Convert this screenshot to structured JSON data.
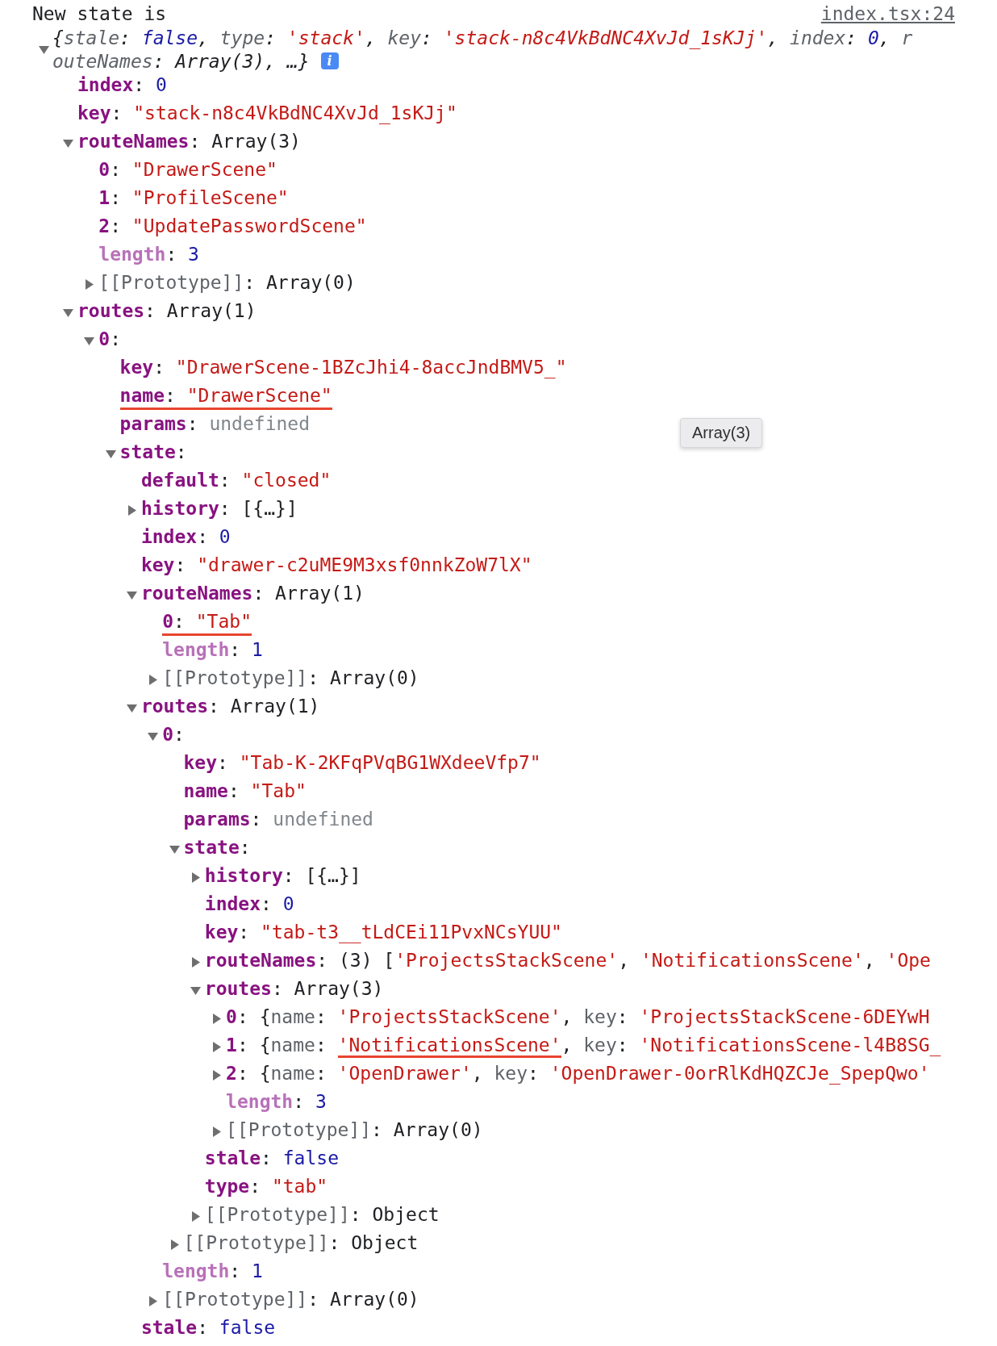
{
  "log": {
    "message": "New state is",
    "source": "index.tsx:24",
    "summary": {
      "expanded": true,
      "info_badge": "i",
      "lines": [
        [
          {
            "text": "{",
            "kind": "plain"
          },
          {
            "text": "stale",
            "kind": "prop"
          },
          {
            "text": ": ",
            "kind": "plain"
          },
          {
            "text": "false",
            "kind": "number"
          },
          {
            "text": ", ",
            "kind": "plain"
          },
          {
            "text": "type",
            "kind": "prop"
          },
          {
            "text": ": ",
            "kind": "plain"
          },
          {
            "text": "'stack'",
            "kind": "string"
          },
          {
            "text": ", ",
            "kind": "plain"
          },
          {
            "text": "key",
            "kind": "prop"
          },
          {
            "text": ": ",
            "kind": "plain"
          },
          {
            "text": "'stack-n8c4VkBdNC4XvJd_1sKJj'",
            "kind": "string"
          },
          {
            "text": ", ",
            "kind": "plain"
          },
          {
            "text": "index",
            "kind": "prop"
          },
          {
            "text": ": ",
            "kind": "plain"
          },
          {
            "text": "0",
            "kind": "number"
          },
          {
            "text": ", ",
            "kind": "plain"
          },
          {
            "text": "r",
            "kind": "prop"
          }
        ],
        [
          {
            "text": "outeNames",
            "kind": "prop"
          },
          {
            "text": ": Array(3), …}",
            "kind": "plain"
          }
        ]
      ]
    },
    "children": [
      {
        "key": "index",
        "kind": "own",
        "value": [
          {
            "text": ": ",
            "kind": "plain"
          },
          {
            "text": "0",
            "kind": "number"
          }
        ]
      },
      {
        "key": "key",
        "kind": "own",
        "value": [
          {
            "text": ": ",
            "kind": "plain"
          },
          {
            "text": "\"stack-n8c4VkBdNC4XvJd_1sKJj\"",
            "kind": "string"
          }
        ]
      },
      {
        "key": "routeNames",
        "kind": "own",
        "expanded": true,
        "value": [
          {
            "text": ": Array(3)",
            "kind": "plain"
          }
        ],
        "children": [
          {
            "key": "0",
            "kind": "own",
            "value": [
              {
                "text": ": ",
                "kind": "plain"
              },
              {
                "text": "\"DrawerScene\"",
                "kind": "string"
              }
            ]
          },
          {
            "key": "1",
            "kind": "own",
            "value": [
              {
                "text": ": ",
                "kind": "plain"
              },
              {
                "text": "\"ProfileScene\"",
                "kind": "string"
              }
            ]
          },
          {
            "key": "2",
            "kind": "own",
            "value": [
              {
                "text": ": ",
                "kind": "plain"
              },
              {
                "text": "\"UpdatePasswordScene\"",
                "kind": "string"
              }
            ]
          },
          {
            "key": "length",
            "kind": "internal",
            "value": [
              {
                "text": ": ",
                "kind": "plain"
              },
              {
                "text": "3",
                "kind": "number"
              }
            ]
          },
          {
            "key": "[[Prototype]]",
            "kind": "proto",
            "expanded": false,
            "value": [
              {
                "text": ": Array(0)",
                "kind": "plain"
              }
            ]
          }
        ]
      },
      {
        "key": "routes",
        "kind": "own",
        "expanded": true,
        "value": [
          {
            "text": ": Array(1)",
            "kind": "plain"
          }
        ],
        "children": [
          {
            "key": "0",
            "kind": "own",
            "expanded": true,
            "value": [
              {
                "text": ":",
                "kind": "plain"
              }
            ],
            "children": [
              {
                "key": "key",
                "kind": "own",
                "value": [
                  {
                    "text": ": ",
                    "kind": "plain"
                  },
                  {
                    "text": "\"DrawerScene-1BZcJhi4-8accJndBMV5_\"",
                    "kind": "string"
                  }
                ]
              },
              {
                "key": "name",
                "kind": "own",
                "underlined": true,
                "value": [
                  {
                    "text": ": ",
                    "kind": "plain"
                  },
                  {
                    "text": "\"DrawerScene\"",
                    "kind": "string"
                  }
                ]
              },
              {
                "key": "params",
                "kind": "own",
                "value": [
                  {
                    "text": ": ",
                    "kind": "plain"
                  },
                  {
                    "text": "undefined",
                    "kind": "undefined"
                  }
                ]
              },
              {
                "key": "state",
                "kind": "own",
                "expanded": true,
                "value": [
                  {
                    "text": ":",
                    "kind": "plain"
                  }
                ],
                "children": [
                  {
                    "key": "default",
                    "kind": "own",
                    "value": [
                      {
                        "text": ": ",
                        "kind": "plain"
                      },
                      {
                        "text": "\"closed\"",
                        "kind": "string"
                      }
                    ]
                  },
                  {
                    "key": "history",
                    "kind": "own",
                    "expanded": false,
                    "value": [
                      {
                        "text": ": [{…}]",
                        "kind": "plain"
                      }
                    ]
                  },
                  {
                    "key": "index",
                    "kind": "own",
                    "value": [
                      {
                        "text": ": ",
                        "kind": "plain"
                      },
                      {
                        "text": "0",
                        "kind": "number"
                      }
                    ]
                  },
                  {
                    "key": "key",
                    "kind": "own",
                    "value": [
                      {
                        "text": ": ",
                        "kind": "plain"
                      },
                      {
                        "text": "\"drawer-c2uME9M3xsf0nnkZoW7lX\"",
                        "kind": "string"
                      }
                    ]
                  },
                  {
                    "key": "routeNames",
                    "kind": "own",
                    "expanded": true,
                    "value": [
                      {
                        "text": ": Array(1)",
                        "kind": "plain"
                      }
                    ],
                    "children": [
                      {
                        "key": "0",
                        "kind": "own",
                        "underlined": true,
                        "value": [
                          {
                            "text": ": ",
                            "kind": "plain"
                          },
                          {
                            "text": "\"Tab\"",
                            "kind": "string"
                          }
                        ]
                      },
                      {
                        "key": "length",
                        "kind": "internal",
                        "value": [
                          {
                            "text": ": ",
                            "kind": "plain"
                          },
                          {
                            "text": "1",
                            "kind": "number"
                          }
                        ]
                      },
                      {
                        "key": "[[Prototype]]",
                        "kind": "proto",
                        "expanded": false,
                        "value": [
                          {
                            "text": ": Array(0)",
                            "kind": "plain"
                          }
                        ]
                      }
                    ]
                  },
                  {
                    "key": "routes",
                    "kind": "own",
                    "expanded": true,
                    "value": [
                      {
                        "text": ": Array(1)",
                        "kind": "plain"
                      }
                    ],
                    "children": [
                      {
                        "key": "0",
                        "kind": "own",
                        "expanded": true,
                        "value": [
                          {
                            "text": ":",
                            "kind": "plain"
                          }
                        ],
                        "children": [
                          {
                            "key": "key",
                            "kind": "own",
                            "value": [
                              {
                                "text": ": ",
                                "kind": "plain"
                              },
                              {
                                "text": "\"Tab-K-2KFqPVqBG1WXdeeVfp7\"",
                                "kind": "string"
                              }
                            ]
                          },
                          {
                            "key": "name",
                            "kind": "own",
                            "value": [
                              {
                                "text": ": ",
                                "kind": "plain"
                              },
                              {
                                "text": "\"Tab\"",
                                "kind": "string"
                              }
                            ]
                          },
                          {
                            "key": "params",
                            "kind": "own",
                            "value": [
                              {
                                "text": ": ",
                                "kind": "plain"
                              },
                              {
                                "text": "undefined",
                                "kind": "undefined"
                              }
                            ]
                          },
                          {
                            "key": "state",
                            "kind": "own",
                            "expanded": true,
                            "value": [
                              {
                                "text": ":",
                                "kind": "plain"
                              }
                            ],
                            "children": [
                              {
                                "key": "history",
                                "kind": "own",
                                "expanded": false,
                                "value": [
                                  {
                                    "text": ": [{…}]",
                                    "kind": "plain"
                                  }
                                ]
                              },
                              {
                                "key": "index",
                                "kind": "own",
                                "value": [
                                  {
                                    "text": ": ",
                                    "kind": "plain"
                                  },
                                  {
                                    "text": "0",
                                    "kind": "number"
                                  }
                                ]
                              },
                              {
                                "key": "key",
                                "kind": "own",
                                "value": [
                                  {
                                    "text": ": ",
                                    "kind": "plain"
                                  },
                                  {
                                    "text": "\"tab-t3__tLdCEi11PvxNCsYUU\"",
                                    "kind": "string"
                                  }
                                ]
                              },
                              {
                                "key": "routeNames",
                                "kind": "own",
                                "expanded": false,
                                "value": [
                                  {
                                    "text": ": (3) [",
                                    "kind": "plain"
                                  },
                                  {
                                    "text": "'ProjectsStackScene'",
                                    "kind": "string"
                                  },
                                  {
                                    "text": ", ",
                                    "kind": "plain"
                                  },
                                  {
                                    "text": "'NotificationsScene'",
                                    "kind": "string"
                                  },
                                  {
                                    "text": ", ",
                                    "kind": "plain"
                                  },
                                  {
                                    "text": "'Ope",
                                    "kind": "string"
                                  }
                                ]
                              },
                              {
                                "key": "routes",
                                "kind": "own",
                                "expanded": true,
                                "value": [
                                  {
                                    "text": ": Array(3)",
                                    "kind": "plain"
                                  }
                                ],
                                "children": [
                                  {
                                    "key": "0",
                                    "kind": "own",
                                    "expanded": false,
                                    "value": [
                                      {
                                        "text": ": {",
                                        "kind": "plain"
                                      },
                                      {
                                        "text": "name",
                                        "kind": "prop"
                                      },
                                      {
                                        "text": ": ",
                                        "kind": "plain"
                                      },
                                      {
                                        "text": "'ProjectsStackScene'",
                                        "kind": "string"
                                      },
                                      {
                                        "text": ", ",
                                        "kind": "plain"
                                      },
                                      {
                                        "text": "key",
                                        "kind": "prop"
                                      },
                                      {
                                        "text": ": ",
                                        "kind": "plain"
                                      },
                                      {
                                        "text": "'ProjectsStackScene-6DEYwH",
                                        "kind": "string"
                                      }
                                    ]
                                  },
                                  {
                                    "key": "1",
                                    "kind": "own",
                                    "expanded": false,
                                    "value": [
                                      {
                                        "text": ": {",
                                        "kind": "plain"
                                      },
                                      {
                                        "text": "name",
                                        "kind": "prop"
                                      },
                                      {
                                        "text": ": ",
                                        "kind": "plain"
                                      },
                                      {
                                        "text": "'NotificationsScene'",
                                        "kind": "string",
                                        "underlined": true
                                      },
                                      {
                                        "text": ", ",
                                        "kind": "plain"
                                      },
                                      {
                                        "text": "key",
                                        "kind": "prop"
                                      },
                                      {
                                        "text": ": ",
                                        "kind": "plain"
                                      },
                                      {
                                        "text": "'NotificationsScene-l4B8SG_",
                                        "kind": "string"
                                      }
                                    ]
                                  },
                                  {
                                    "key": "2",
                                    "kind": "own",
                                    "expanded": false,
                                    "value": [
                                      {
                                        "text": ": {",
                                        "kind": "plain"
                                      },
                                      {
                                        "text": "name",
                                        "kind": "prop"
                                      },
                                      {
                                        "text": ": ",
                                        "kind": "plain"
                                      },
                                      {
                                        "text": "'OpenDrawer'",
                                        "kind": "string"
                                      },
                                      {
                                        "text": ", ",
                                        "kind": "plain"
                                      },
                                      {
                                        "text": "key",
                                        "kind": "prop"
                                      },
                                      {
                                        "text": ": ",
                                        "kind": "plain"
                                      },
                                      {
                                        "text": "'OpenDrawer-0orRlKdHQZCJe_SpepQwo'",
                                        "kind": "string"
                                      }
                                    ]
                                  },
                                  {
                                    "key": "length",
                                    "kind": "internal",
                                    "value": [
                                      {
                                        "text": ": ",
                                        "kind": "plain"
                                      },
                                      {
                                        "text": "3",
                                        "kind": "number"
                                      }
                                    ]
                                  },
                                  {
                                    "key": "[[Prototype]]",
                                    "kind": "proto",
                                    "expanded": false,
                                    "value": [
                                      {
                                        "text": ": Array(0)",
                                        "kind": "plain"
                                      }
                                    ]
                                  }
                                ]
                              },
                              {
                                "key": "stale",
                                "kind": "own",
                                "value": [
                                  {
                                    "text": ": ",
                                    "kind": "plain"
                                  },
                                  {
                                    "text": "false",
                                    "kind": "number"
                                  }
                                ]
                              },
                              {
                                "key": "type",
                                "kind": "own",
                                "value": [
                                  {
                                    "text": ": ",
                                    "kind": "plain"
                                  },
                                  {
                                    "text": "\"tab\"",
                                    "kind": "string"
                                  }
                                ]
                              },
                              {
                                "key": "[[Prototype]]",
                                "kind": "proto",
                                "expanded": false,
                                "value": [
                                  {
                                    "text": ": Object",
                                    "kind": "plain"
                                  }
                                ]
                              }
                            ]
                          },
                          {
                            "key": "[[Prototype]]",
                            "kind": "proto",
                            "expanded": false,
                            "value": [
                              {
                                "text": ": Object",
                                "kind": "plain"
                              }
                            ]
                          }
                        ]
                      },
                      {
                        "key": "length",
                        "kind": "internal",
                        "value": [
                          {
                            "text": ": ",
                            "kind": "plain"
                          },
                          {
                            "text": "1",
                            "kind": "number"
                          }
                        ]
                      },
                      {
                        "key": "[[Prototype]]",
                        "kind": "proto",
                        "expanded": false,
                        "value": [
                          {
                            "text": ": Array(0)",
                            "kind": "plain"
                          }
                        ]
                      }
                    ]
                  },
                  {
                    "key": "stale",
                    "kind": "own",
                    "value": [
                      {
                        "text": ": ",
                        "kind": "plain"
                      },
                      {
                        "text": "false",
                        "kind": "number"
                      }
                    ]
                  }
                ]
              }
            ]
          }
        ]
      }
    ]
  },
  "tooltip": {
    "text": "Array(3)"
  }
}
